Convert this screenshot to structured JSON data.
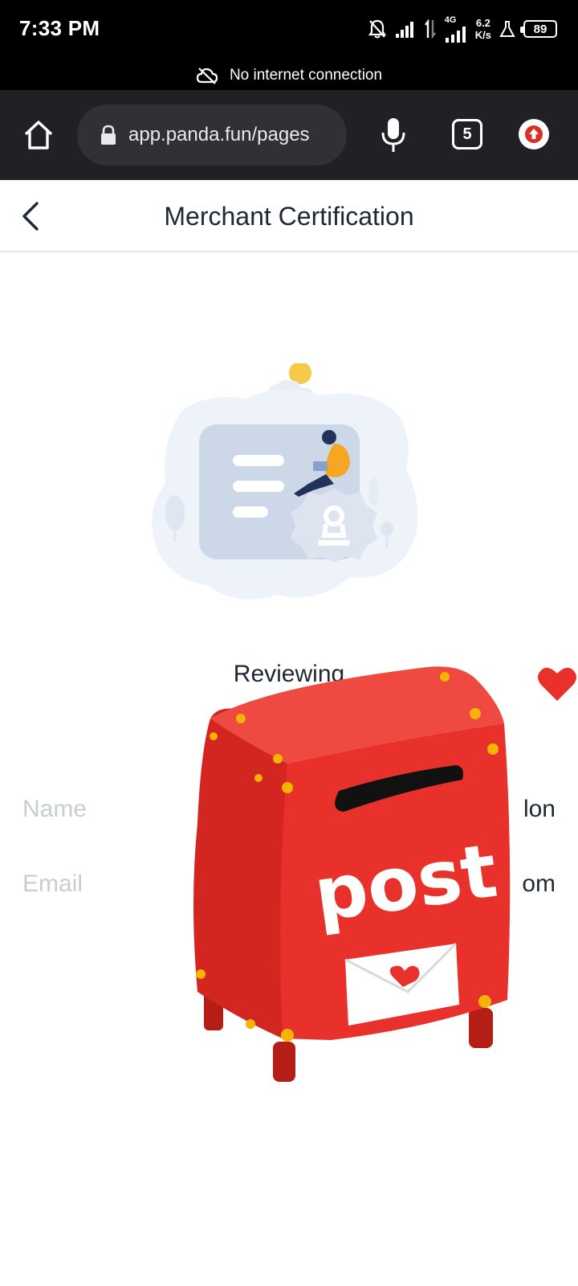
{
  "status_bar": {
    "time": "7:33 PM",
    "network": "4G",
    "speed_value": "6.2",
    "speed_unit": "K/s",
    "battery": "89"
  },
  "notice": {
    "text": "No internet connection"
  },
  "browser": {
    "url": "app.panda.fun/pages",
    "tab_count": "5"
  },
  "header": {
    "title": "Merchant Certification"
  },
  "review": {
    "status": "Reviewing"
  },
  "fields": [
    {
      "label": "Name",
      "value": "lon"
    },
    {
      "label": "Email",
      "value": "om"
    }
  ],
  "sticker": {
    "text": "post"
  },
  "colors": {
    "postbox_red": "#e8312b",
    "accent_yellow": "#f4b400",
    "heart": "#e8312b",
    "label_gray": "#c9cdd2",
    "title_dark": "#1e2833",
    "toolbar_bg": "#202124"
  }
}
